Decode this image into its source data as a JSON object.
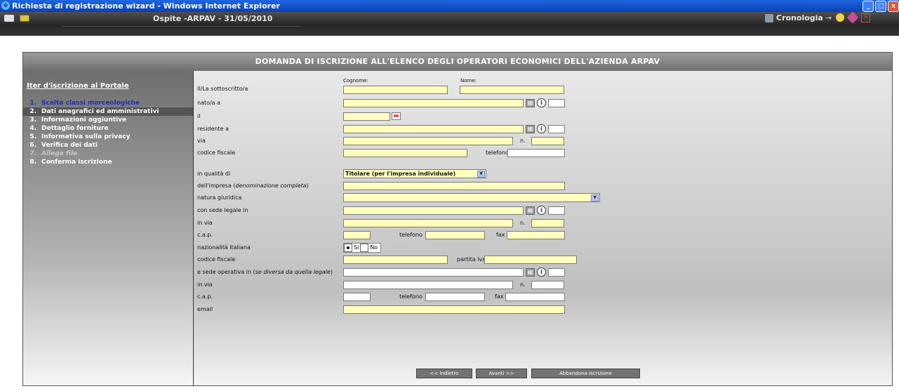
{
  "window": {
    "title": "Richiesta di registrazione wizard - Windows Internet Explorer"
  },
  "toolbar": {
    "user_label": "Ospite -ARPAV - 31/05/2010",
    "history_label": "Cronologia",
    "arrow_glyph": "→"
  },
  "header": {
    "title": "DOMANDA DI ISCRIZIONE ALL'ELENCO DEGLI OPERATORI ECONOMICI DELL'AZIENDA ARPAV"
  },
  "sidebar": {
    "title": "Iter d'iscrizione al Portale",
    "items": [
      {
        "num": "1.",
        "label": "Scelta classi merceologiche",
        "state": "visited"
      },
      {
        "num": "2.",
        "label": "Dati anagrafici ed amministrativi",
        "state": "current"
      },
      {
        "num": "3.",
        "label": "Informazioni aggiuntive",
        "state": "normal"
      },
      {
        "num": "4.",
        "label": "Dettaglio forniture",
        "state": "normal"
      },
      {
        "num": "5.",
        "label": "Informativa sulla privacy",
        "state": "normal"
      },
      {
        "num": "6.",
        "label": "Verifica dei dati",
        "state": "normal"
      },
      {
        "num": "7.",
        "label": "Allega file",
        "state": "disabled"
      },
      {
        "num": "8.",
        "label": "Conferma iscrizione",
        "state": "normal"
      }
    ]
  },
  "form": {
    "sottoscritto": "Il/La sottoscritto/a",
    "cognome": "Cognome:",
    "nome": "Nome:",
    "nato_a": "nato/a a",
    "il": "il",
    "residente_a": "residente a",
    "via": "via",
    "n": "n.",
    "codice_fiscale": "codice fiscale",
    "telefono": "telefono",
    "in_qualita_di": "in qualità di",
    "qualita_value": "Titolare (per l'impresa individuale)",
    "impresa_prefix": "dell'impresa (",
    "impresa_italic": "denominazione completa",
    "impresa_suffix": ")",
    "natura_giuridica": "natura giuridica",
    "sede_legale": "con sede legale in",
    "in_via": "in via",
    "cap": "c.a.p.",
    "fax": "fax",
    "nazionalita": "nazionalità italiana",
    "si": "Si",
    "no": "No",
    "partita_iva": "partita iva",
    "sede_op_prefix": "e sede operativa in (",
    "sede_op_italic": "se diversa da quella legale",
    "sede_op_suffix": ")",
    "email": "email"
  },
  "buttons": {
    "back": "<< Indietro",
    "next": "Avanti >>",
    "abort": "Abbandona iscrizione"
  },
  "colors": {
    "field_yellow": "#ffffbe",
    "header_gray": "#8a8a8a",
    "titlebar_blue": "#0a3fb5",
    "visited_link": "#1a30b8"
  }
}
